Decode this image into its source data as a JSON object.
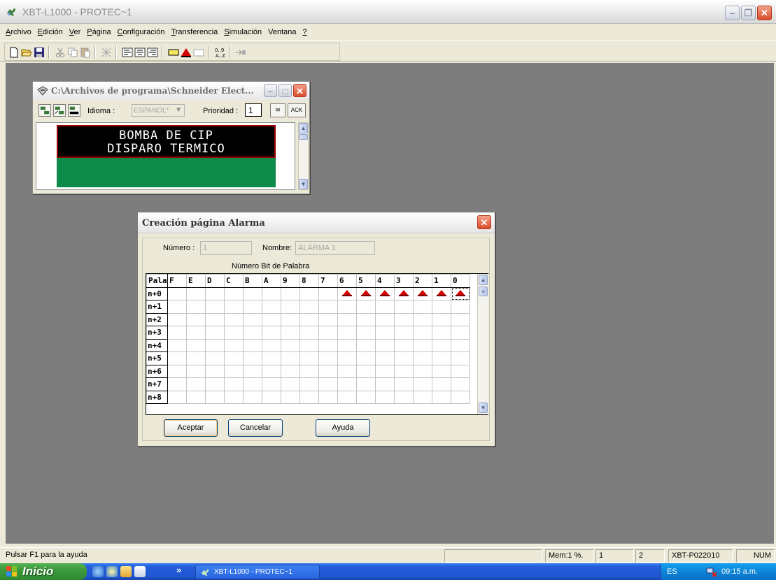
{
  "app": {
    "title": "XBT-L1000 - PROTEC~1",
    "menu": [
      {
        "label": "Archivo",
        "accel": "A",
        "rest": "rchivo"
      },
      {
        "label": "Edición",
        "accel": "E",
        "rest": "dición"
      },
      {
        "label": "Ver",
        "accel": "V",
        "rest": "er"
      },
      {
        "label": "Página",
        "accel": "P",
        "rest": "ágina"
      },
      {
        "label": "Configuración",
        "accel": "C",
        "rest": "onfiguración"
      },
      {
        "label": "Transferencia",
        "accel": "T",
        "rest": "ransferencia"
      },
      {
        "label": "Simulación",
        "accel": "S",
        "rest": "imulación"
      },
      {
        "label": "Ventana",
        "accel": "",
        "rest": ""
      },
      {
        "label": "?",
        "accel": "?",
        "rest": ""
      }
    ],
    "toolbar_icons": [
      "new-file-icon",
      "open-folder-icon",
      "save-icon",
      "cut-icon",
      "copy-icon",
      "paste-icon",
      "pattern-icon",
      "align-left-icon",
      "align-center-icon",
      "align-right-icon",
      "field-icon",
      "alarm-triangle-icon",
      "blank-page-icon",
      "sort-az-icon",
      "transfer-icon"
    ]
  },
  "preview_window": {
    "title": "C:\\Archivos de programa\\Schneider Elect...",
    "idioma_label": "Idioma :",
    "idioma_value": "ESPANOL*",
    "prioridad_label": "Prioridad :",
    "prioridad_value": "1",
    "ack_label": "ACK",
    "lcd_line1": "BOMBA DE CIP",
    "lcd_line2": "DISPARO TERMICO"
  },
  "dialog": {
    "title": "Creación página Alarma",
    "numero_label": "Número :",
    "numero_value": "1",
    "nombre_label": "Nombre:",
    "nombre_value": "ALARMA 1",
    "grid_caption": "Número Bit de Palabra",
    "corner_header": "Pala",
    "bit_headers": [
      "F",
      "E",
      "D",
      "C",
      "B",
      "A",
      "9",
      "8",
      "7",
      "6",
      "5",
      "4",
      "3",
      "2",
      "1",
      "0"
    ],
    "rows": [
      "n+0",
      "n+1",
      "n+2",
      "n+3",
      "n+4",
      "n+5",
      "n+6",
      "n+7",
      "n+8"
    ],
    "alarm_bits_row0": [
      "6",
      "5",
      "4",
      "3",
      "2",
      "1",
      "0"
    ],
    "buttons": {
      "accept": "Aceptar",
      "cancel": "Cancelar",
      "help": "Ayuda"
    }
  },
  "statusbar": {
    "help_text": "Pulsar F1 para la ayuda",
    "mem": "Mem:1 %.",
    "field1": "1",
    "field2": "2",
    "terminal": "XBT-P022010",
    "num": "NUM"
  },
  "taskbar": {
    "start_label": "Inicio",
    "task_label": "XBT-L1000 - PROTEC~1",
    "lang": "ES",
    "clock": "09:15 a.m."
  },
  "colors": {
    "lcd_border": "#9b0000",
    "lcd_green": "#0e8a4a",
    "alarm_red": "#d20000",
    "workspace": "#7d7d7d"
  }
}
